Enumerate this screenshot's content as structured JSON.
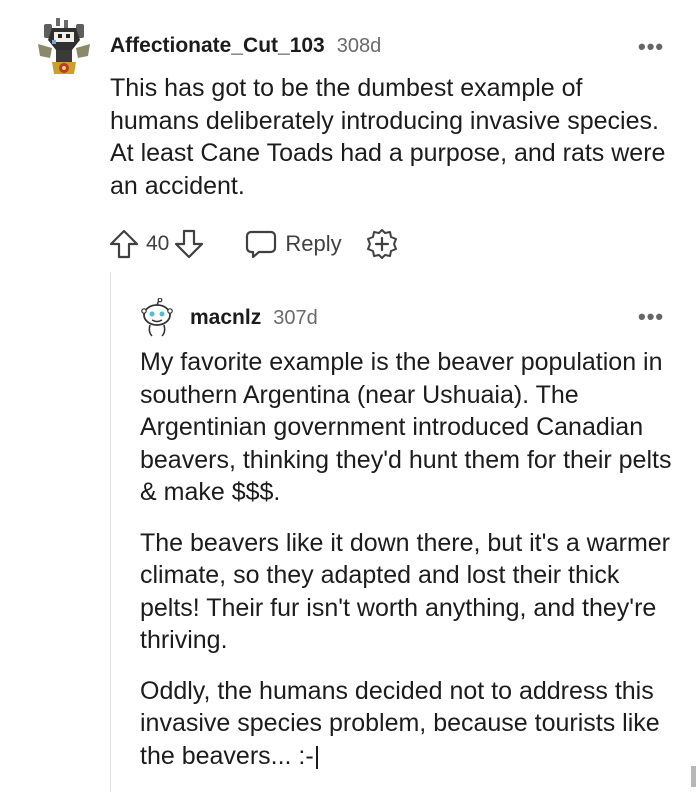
{
  "comments": [
    {
      "author": "Affectionate_Cut_103",
      "age": "308d",
      "body": "This has got to be the dumbest example of humans deliberately introducing invasive species. At least Cane Toads had a purpose, and rats were an accident.",
      "votes": "40",
      "reply_label": "Reply",
      "more_label": "•••"
    },
    {
      "author": "macnlz",
      "age": "307d",
      "paragraphs": [
        "My favorite example is the beaver population in southern Argentina (near Ushuaia). The Argentinian government introduced Canadian beavers, thinking they'd hunt them for their pelts & make $$$.",
        "The beavers like it down there, but it's a warmer climate, so they adapted and lost their thick pelts! Their fur isn't worth anything, and they're thriving.",
        "Oddly, the humans decided not to address this invasive species problem, because tourists like the beavers... :-|"
      ],
      "more_label": "•••"
    }
  ],
  "icons": {
    "upvote": "arrow-up-icon",
    "downvote": "arrow-down-icon",
    "reply": "speech-bubble-icon",
    "award": "award-plus-icon"
  },
  "colors": {
    "text": "#1c1c1c",
    "muted": "#6a6a6a",
    "thread_line": "#e3e3e3"
  }
}
